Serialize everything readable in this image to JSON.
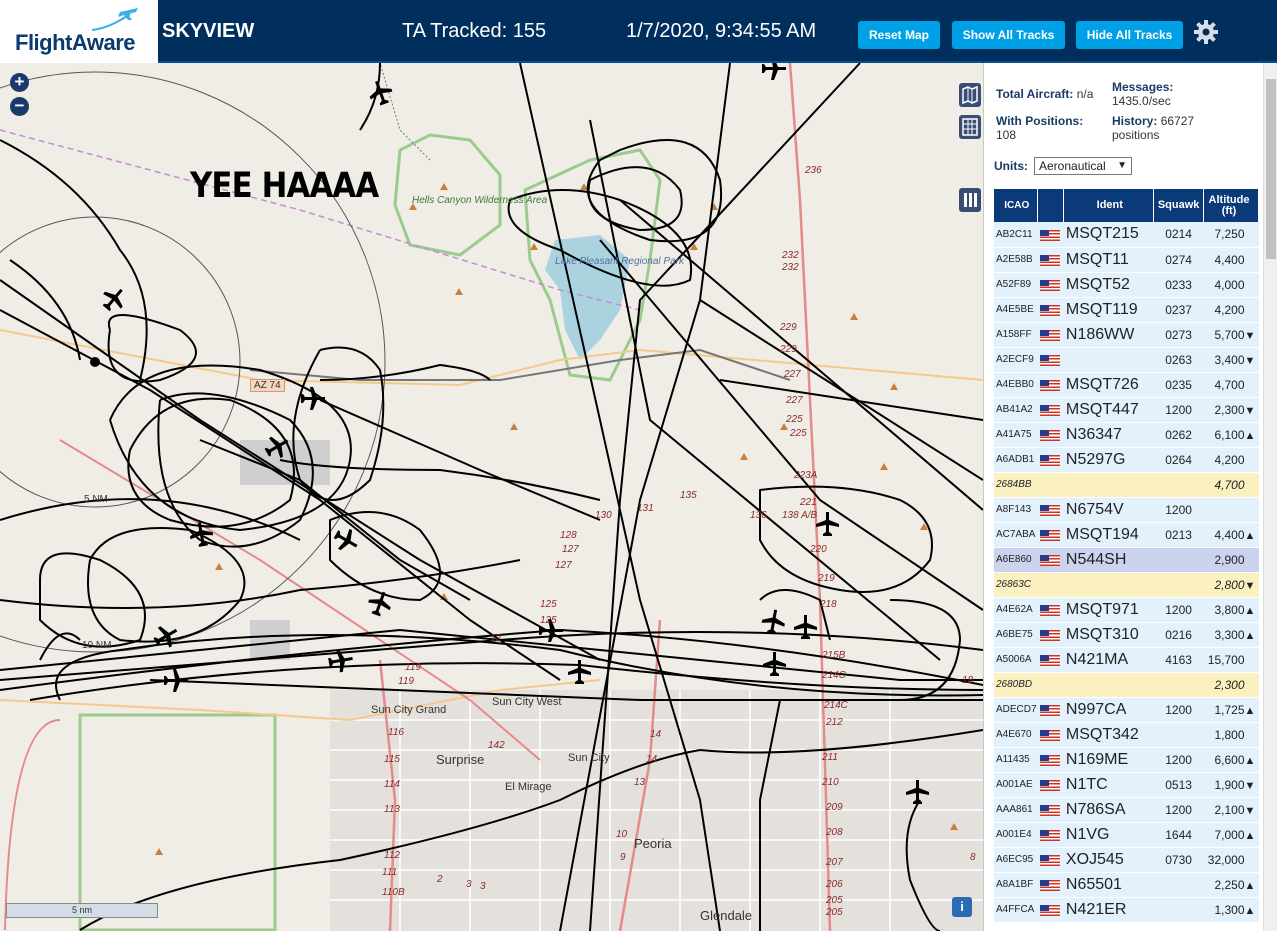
{
  "header": {
    "logo_text": "FlightAware",
    "title": "SKYVIEW",
    "tracked": "TA Tracked: 155",
    "clock": "1/7/2020, 9:34:55 AM",
    "reset_label": "Reset Map",
    "show_label": "Show All Tracks",
    "hide_label": "Hide All Tracks"
  },
  "map": {
    "annotation": "YEE HAAAA",
    "zoom_in": "+",
    "zoom_out": "−",
    "scale": "5 nm",
    "labels": {
      "hells_canyon": "Hells Canyon Wilderness Area",
      "lake_pleasant": "Lake Pleasant Regional Park",
      "az74": "AZ 74",
      "sun_city_grand": "Sun City Grand",
      "sun_city_west": "Sun City West",
      "surprise": "Surprise",
      "sun_city": "Sun City",
      "el_mirage": "El Mirage",
      "peoria": "Peoria",
      "glendale": "Glendale",
      "ring_5nm": "5 NM",
      "ring_10nm": "10 NM"
    }
  },
  "stats": {
    "total_label": "Total Aircraft:",
    "total_value": "n/a",
    "positions_label": "With Positions:",
    "positions_value": "108",
    "messages_label": "Messages:",
    "messages_value": "1435.0/sec",
    "history_label": "History:",
    "history_value": "66727",
    "history_unit": "positions"
  },
  "units": {
    "label": "Units:",
    "value": "Aeronautical"
  },
  "table": {
    "headers": {
      "icao": "ICAO",
      "ident": "Ident",
      "squawk": "Squawk",
      "altitude": "Altitude (ft)"
    },
    "rows": [
      {
        "icao": "AB2C11",
        "ident": "MSQT215",
        "squawk": "0214",
        "alt": "7,250",
        "trend": "",
        "style": ""
      },
      {
        "icao": "A2E58B",
        "ident": "MSQT11",
        "squawk": "0274",
        "alt": "4,400",
        "trend": "",
        "style": ""
      },
      {
        "icao": "A52F89",
        "ident": "MSQT52",
        "squawk": "0233",
        "alt": "4,000",
        "trend": "",
        "style": ""
      },
      {
        "icao": "A4E5BE",
        "ident": "MSQT119",
        "squawk": "0237",
        "alt": "4,200",
        "trend": "",
        "style": ""
      },
      {
        "icao": "A158FF",
        "ident": "N186WW",
        "squawk": "0273",
        "alt": "5,700",
        "trend": "▼",
        "style": ""
      },
      {
        "icao": "A2ECF9",
        "ident": "",
        "squawk": "0263",
        "alt": "3,400",
        "trend": "▼",
        "style": ""
      },
      {
        "icao": "A4EBB0",
        "ident": "MSQT726",
        "squawk": "0235",
        "alt": "4,700",
        "trend": "",
        "style": ""
      },
      {
        "icao": "AB41A2",
        "ident": "MSQT447",
        "squawk": "1200",
        "alt": "2,300",
        "trend": "▼",
        "style": ""
      },
      {
        "icao": "A41A75",
        "ident": "N36347",
        "squawk": "0262",
        "alt": "6,100",
        "trend": "▲",
        "style": ""
      },
      {
        "icao": "A6ADB1",
        "ident": "N5297G",
        "squawk": "0264",
        "alt": "4,200",
        "trend": "",
        "style": ""
      },
      {
        "icao": "2684BB",
        "ident": "",
        "squawk": "",
        "alt": "4,700",
        "trend": "",
        "style": "yellow"
      },
      {
        "icao": "A8F143",
        "ident": "N6754V",
        "squawk": "1200",
        "alt": "",
        "trend": "",
        "style": ""
      },
      {
        "icao": "AC7ABA",
        "ident": "MSQT194",
        "squawk": "0213",
        "alt": "4,400",
        "trend": "▲",
        "style": ""
      },
      {
        "icao": "A6E860",
        "ident": "N544SH",
        "squawk": "",
        "alt": "2,900",
        "trend": "",
        "style": "sel"
      },
      {
        "icao": "26863C",
        "ident": "",
        "squawk": "",
        "alt": "2,800",
        "trend": "▼",
        "style": "yellow"
      },
      {
        "icao": "A4E62A",
        "ident": "MSQT971",
        "squawk": "1200",
        "alt": "3,800",
        "trend": "▲",
        "style": ""
      },
      {
        "icao": "A6BE75",
        "ident": "MSQT310",
        "squawk": "0216",
        "alt": "3,300",
        "trend": "▲",
        "style": ""
      },
      {
        "icao": "A5006A",
        "ident": "N421MA",
        "squawk": "4163",
        "alt": "15,700",
        "trend": "",
        "style": ""
      },
      {
        "icao": "2680BD",
        "ident": "",
        "squawk": "",
        "alt": "2,300",
        "trend": "",
        "style": "yellow"
      },
      {
        "icao": "ADECD7",
        "ident": "N997CA",
        "squawk": "1200",
        "alt": "1,725",
        "trend": "▲",
        "style": ""
      },
      {
        "icao": "A4E670",
        "ident": "MSQT342",
        "squawk": "",
        "alt": "1,800",
        "trend": "",
        "style": ""
      },
      {
        "icao": "A11435",
        "ident": "N169ME",
        "squawk": "1200",
        "alt": "6,600",
        "trend": "▲",
        "style": ""
      },
      {
        "icao": "A001AE",
        "ident": "N1TC",
        "squawk": "0513",
        "alt": "1,900",
        "trend": "▼",
        "style": ""
      },
      {
        "icao": "AAA861",
        "ident": "N786SA",
        "squawk": "1200",
        "alt": "2,100",
        "trend": "▼",
        "style": ""
      },
      {
        "icao": "A001E4",
        "ident": "N1VG",
        "squawk": "1644",
        "alt": "7,000",
        "trend": "▲",
        "style": ""
      },
      {
        "icao": "A6EC95",
        "ident": "XOJ545",
        "squawk": "0730",
        "alt": "32,000",
        "trend": "",
        "style": ""
      },
      {
        "icao": "A8A1BF",
        "ident": "N65501",
        "squawk": "",
        "alt": "2,250",
        "trend": "▲",
        "style": ""
      },
      {
        "icao": "A4FFCA",
        "ident": "N421ER",
        "squawk": "",
        "alt": "1,300",
        "trend": "▲",
        "style": ""
      }
    ]
  },
  "colors": {
    "header_bg": "#002f5d",
    "button_bg": "#00a0e6",
    "table_header": "#0b3a7a",
    "row_bg": "#e2f1fb",
    "row_yellow": "#fbf0c0",
    "row_selected": "#cbd3ef",
    "map_bg": "#f0ede6"
  },
  "icons": [
    "gear-icon",
    "zoom-in-icon",
    "zoom-out-icon",
    "map-layers-icon",
    "grid-icon",
    "columns-icon",
    "info-icon",
    "us-flag-icon",
    "aircraft-icon"
  ]
}
